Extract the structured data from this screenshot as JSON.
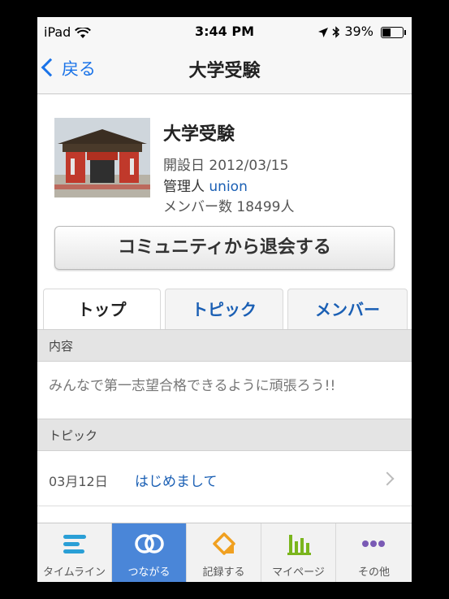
{
  "status_bar": {
    "device": "iPad",
    "time": "3:44 PM",
    "battery": "39%",
    "battery_level": 0.39
  },
  "nav": {
    "back_label": "戻る",
    "title": "大学受験"
  },
  "community": {
    "name": "大学受験",
    "created_label": "開設日 2012/03/15",
    "admin_label": "管理人",
    "admin_name": "union",
    "members_label": "メンバー数 18499人"
  },
  "leave_button": "コミュニティから退会する",
  "tabs": [
    {
      "label": "トップ",
      "active": true
    },
    {
      "label": "トピック",
      "active": false
    },
    {
      "label": "メンバー",
      "active": false
    }
  ],
  "content_section": {
    "header": "内容",
    "text": "みんなで第一志望合格できるように頑張ろう!!"
  },
  "topic_section": {
    "header": "トピック",
    "items": [
      {
        "date": "03月12日",
        "title": "はじめまして"
      }
    ]
  },
  "tab_bar": [
    {
      "label": "タイムライン",
      "icon": "timeline-icon",
      "color": "#2a9fd6",
      "active": false
    },
    {
      "label": "つながる",
      "icon": "connect-icon",
      "color": "#ffffff",
      "active": true
    },
    {
      "label": "記録する",
      "icon": "record-icon",
      "color": "#f0a020",
      "active": false
    },
    {
      "label": "マイページ",
      "icon": "mypage-chart-icon",
      "color": "#7ab51d",
      "active": false
    },
    {
      "label": "その他",
      "icon": "more-icon",
      "color": "#7a5ab5",
      "active": false
    }
  ]
}
